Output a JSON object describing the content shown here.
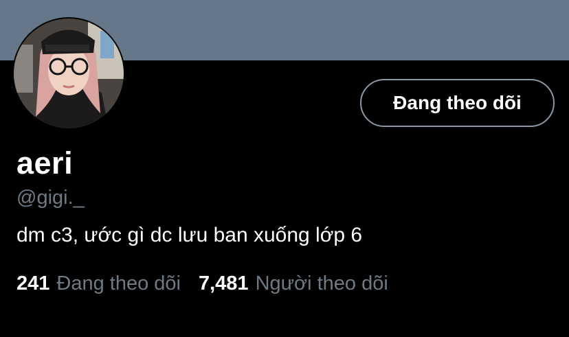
{
  "profile": {
    "display_name": "aeri",
    "handle": "@gigi._",
    "bio": "dm c3, ước gì dc lưu ban xuống lớp 6",
    "follow_button_label": "Đang theo dõi"
  },
  "stats": {
    "following_count": "241",
    "following_label": "Đang theo dõi",
    "followers_count": "7,481",
    "followers_label": "Người theo dõi"
  },
  "colors": {
    "banner": "#66778a",
    "background": "#000000",
    "secondary_text": "#6e7a85",
    "button_border": "#8b98a5"
  }
}
